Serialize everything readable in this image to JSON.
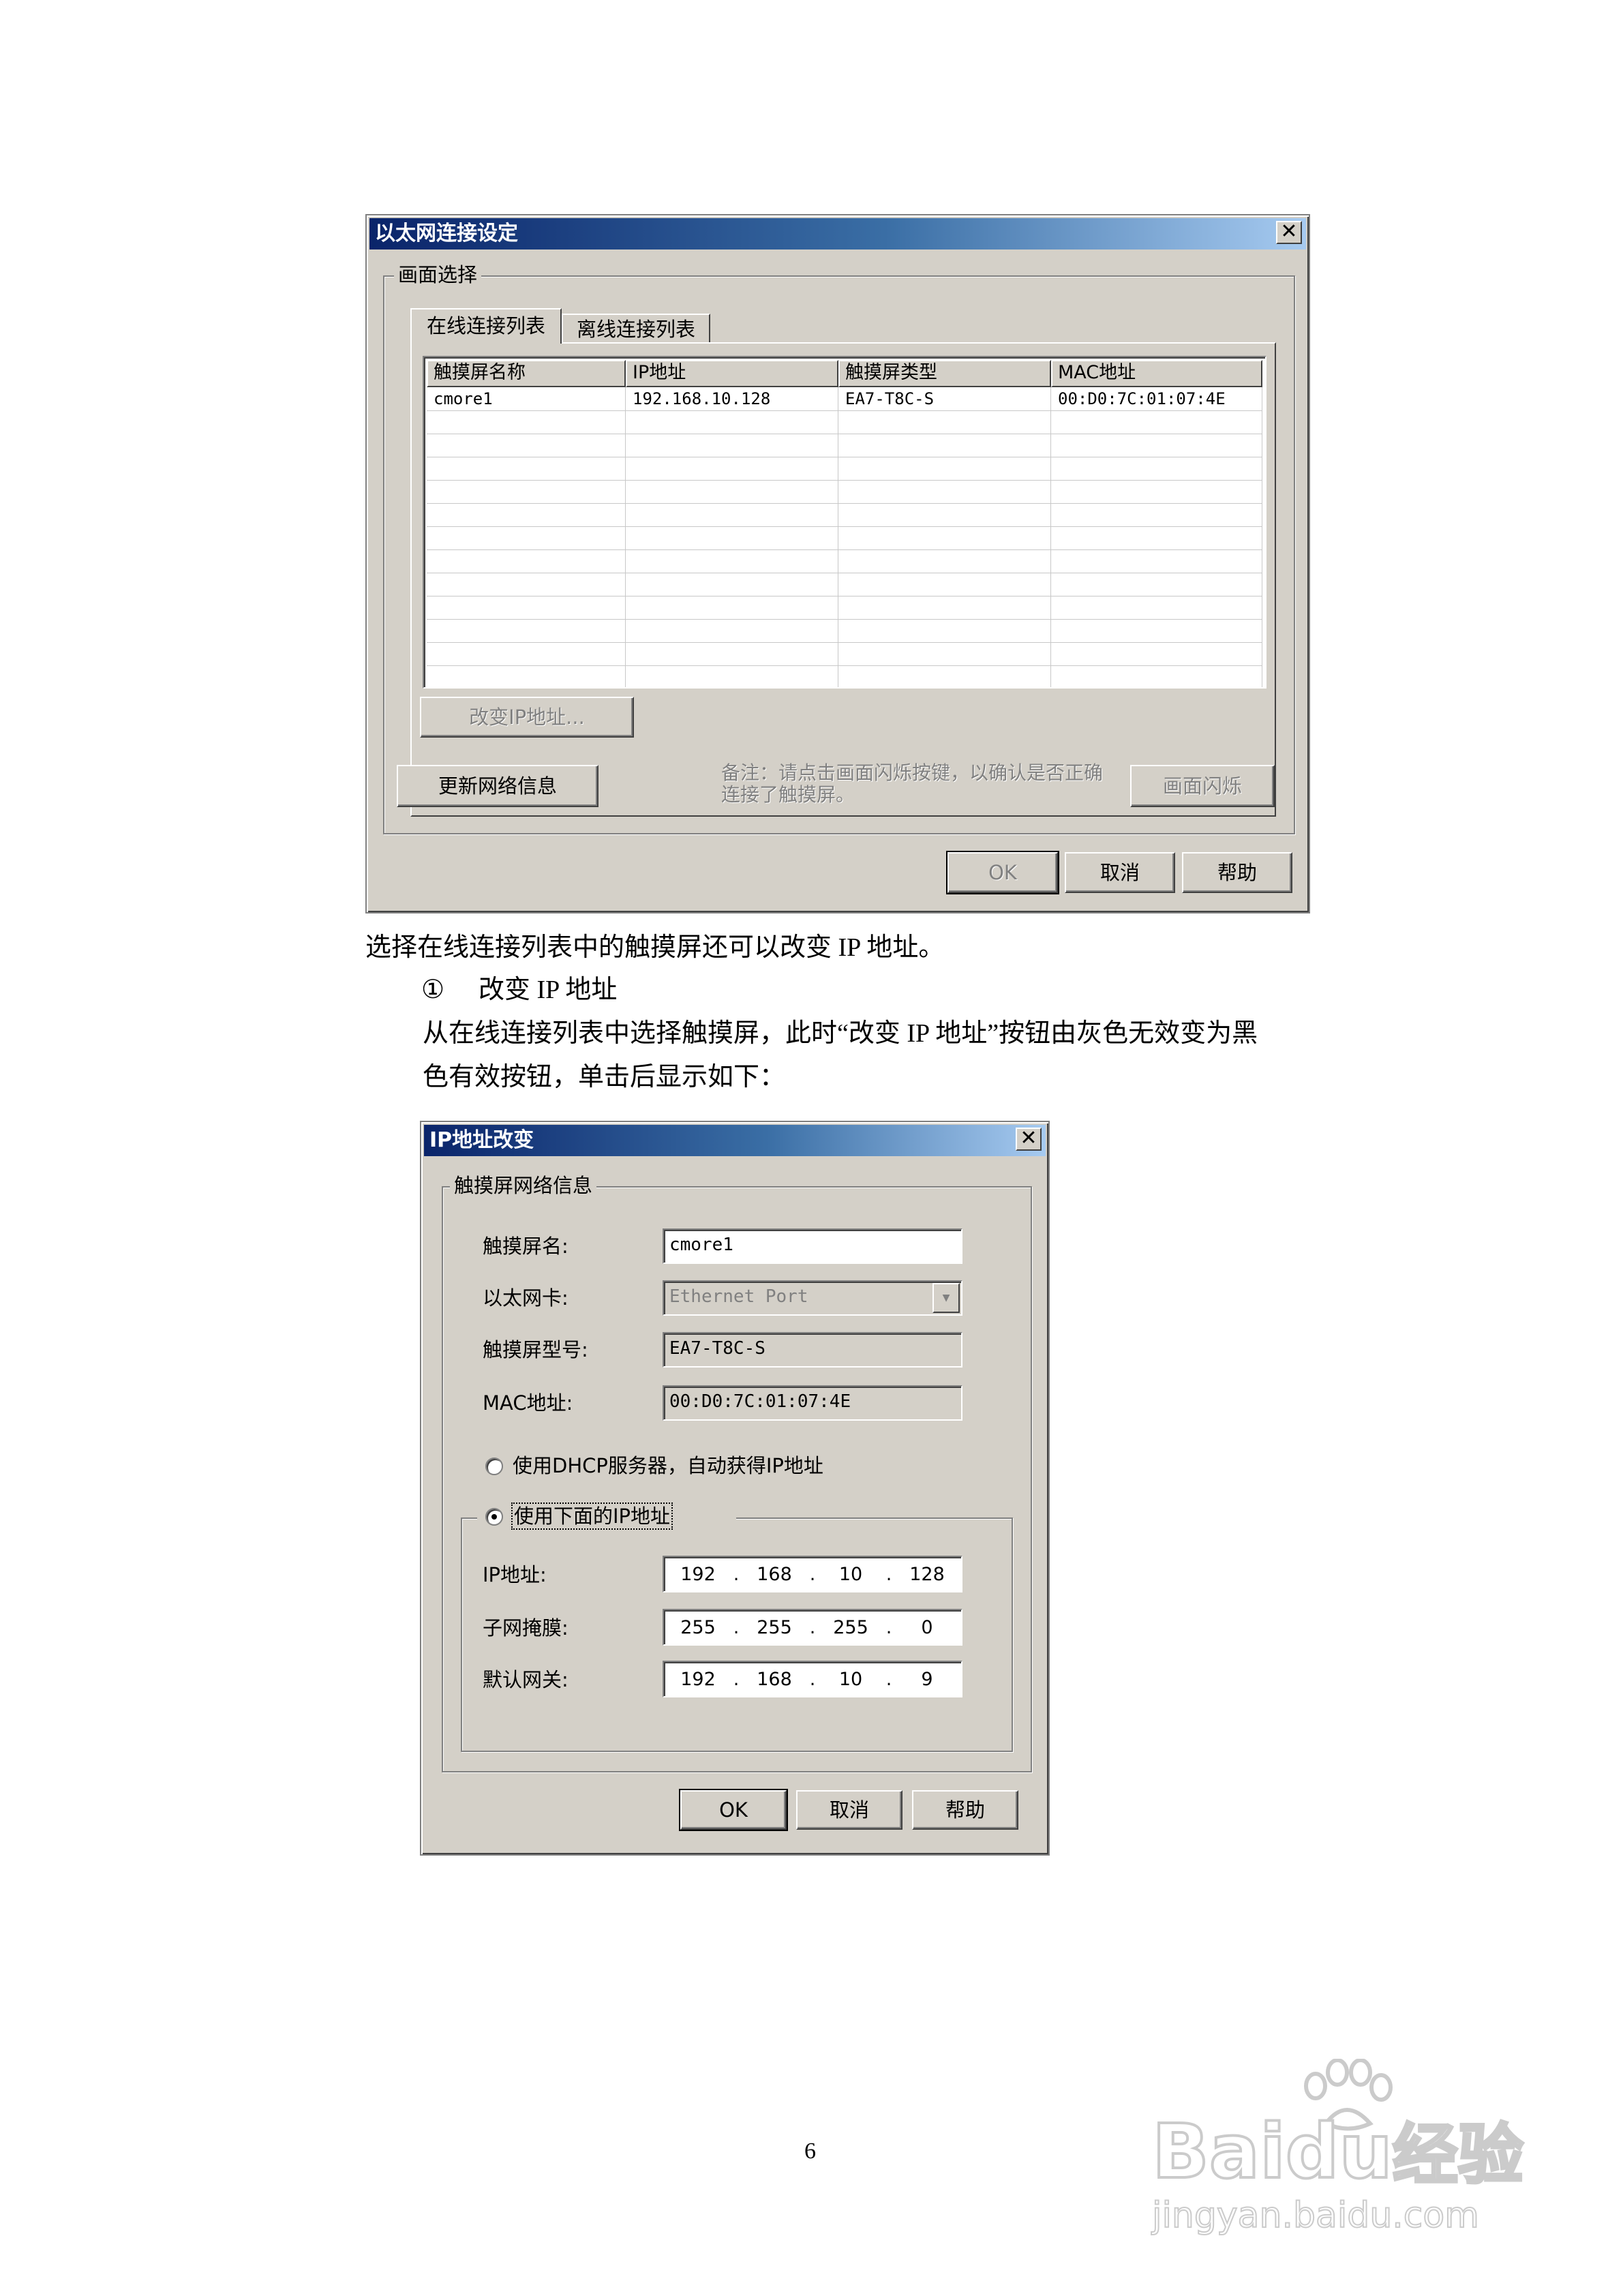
{
  "dialog1": {
    "title": "以太网连接设定",
    "close_glyph": "✕",
    "group_label": "画面选择",
    "tabs": [
      "在线连接列表",
      "离线连接列表"
    ],
    "columns": [
      "触摸屏名称",
      "IP地址",
      "触摸屏类型",
      "MAC地址"
    ],
    "rows": [
      [
        "cmore1",
        "192.168.10.128",
        "EA7-T8C-S",
        "00:D0:7C:01:07:4E"
      ]
    ],
    "change_ip_button": "改变IP地址...",
    "refresh_button": "更新网络信息",
    "note": "备注：请点击画面闪烁按键，以确认是否正确连接了触摸屏。",
    "flash_button": "画面闪烁",
    "ok_button": "OK",
    "cancel_button": "取消",
    "help_button": "帮助"
  },
  "text": {
    "para1": "选择在线连接列表中的触摸屏还可以改变 IP 地址。",
    "item_marker": "①",
    "item_title": "改变 IP 地址",
    "para2_line1": "从在线连接列表中选择触摸屏，此时“改变 IP 地址”按钮由灰色无效变为黑",
    "para2_line2": "色有效按钮，单击后显示如下："
  },
  "dialog2": {
    "title": "IP地址改变",
    "close_glyph": "✕",
    "group_label": "触摸屏网络信息",
    "name_label": "触摸屏名:",
    "name_value": "cmore1",
    "card_label": "以太网卡:",
    "card_value": "Ethernet Port",
    "model_label": "触摸屏型号:",
    "model_value": "EA7-T8C-S",
    "mac_label": "MAC地址:",
    "mac_value": "00:D0:7C:01:07:4E",
    "dhcp_label": "使用DHCP服务器，自动获得IP地址",
    "static_label": "使用下面的IP地址",
    "ip_label": "IP地址:",
    "ip": [
      "192",
      "168",
      "10",
      "128"
    ],
    "mask_label": "子网掩膜:",
    "mask": [
      "255",
      "255",
      "255",
      "0"
    ],
    "gw_label": "默认网关:",
    "gw": [
      "192",
      "168",
      "10",
      "9"
    ],
    "ok_button": "OK",
    "cancel_button": "取消",
    "help_button": "帮助"
  },
  "page_number": "6",
  "watermark": {
    "brand": "Bai",
    "brand2": "du",
    "brand_cn": "经验",
    "url": "jingyan.baidu.com"
  }
}
